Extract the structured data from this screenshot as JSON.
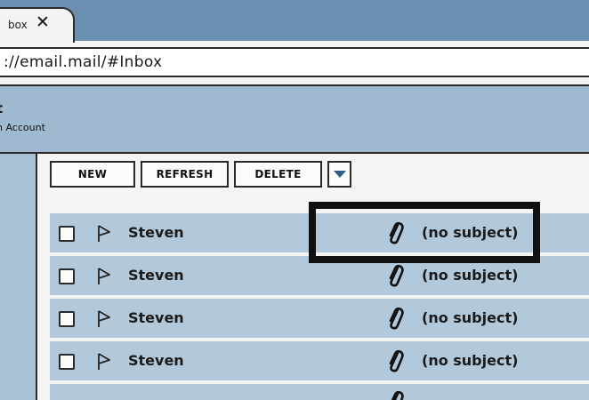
{
  "browser": {
    "tab": {
      "label": "box",
      "close": "✕"
    },
    "address": {
      "url": "://email.mail/#Inbox"
    }
  },
  "header": {
    "title": "t",
    "subtitle": "h Account"
  },
  "toolbar": {
    "new_label": "NEW",
    "refresh_label": "REFRESH",
    "delete_label": "DELETE"
  },
  "emails": [
    {
      "sender": "Steven",
      "subject": "(no subject)",
      "has_attachment": true,
      "highlighted": true
    },
    {
      "sender": "Steven",
      "subject": "(no subject)",
      "has_attachment": true
    },
    {
      "sender": "Steven",
      "subject": "(no subject)",
      "has_attachment": true
    },
    {
      "sender": "Steven",
      "subject": "(no subject)",
      "has_attachment": true
    }
  ],
  "colors": {
    "tab_strip": "#6a8fb0",
    "header": "#9fbad0",
    "row": "#b2c9db",
    "accent": "#2f5f85"
  }
}
